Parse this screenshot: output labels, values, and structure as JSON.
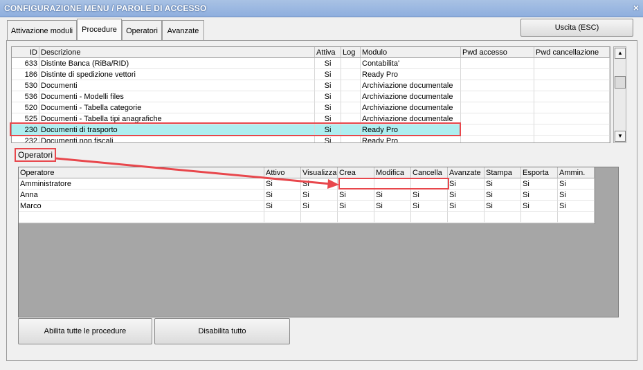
{
  "window": {
    "title": "CONFIGURAZIONE MENU / PAROLE DI ACCESSO",
    "close_glyph": "×"
  },
  "tabs": [
    {
      "label": "Attivazione moduli",
      "active": false
    },
    {
      "label": "Procedure",
      "active": true
    },
    {
      "label": "Operatori",
      "active": false
    },
    {
      "label": "Avanzate",
      "active": false
    }
  ],
  "exit_button": "Uscita (ESC)",
  "procedures": {
    "columns": [
      "ID",
      "Descrizione",
      "Attiva",
      "Log",
      "Modulo",
      "Pwd accesso",
      "Pwd cancellazione"
    ],
    "rows": [
      {
        "id": "633",
        "desc": "Distinte Banca (RiBa/RID)",
        "attiva": "Si",
        "log": "",
        "modulo": "Contabilita'",
        "pwd_acc": "",
        "pwd_canc": ""
      },
      {
        "id": "186",
        "desc": "Distinte di spedizione vettori",
        "attiva": "Si",
        "log": "",
        "modulo": "Ready Pro",
        "pwd_acc": "",
        "pwd_canc": ""
      },
      {
        "id": "530",
        "desc": "Documenti",
        "attiva": "Si",
        "log": "",
        "modulo": "Archiviazione documentale",
        "pwd_acc": "",
        "pwd_canc": ""
      },
      {
        "id": "536",
        "desc": "Documenti - Modelli files",
        "attiva": "Si",
        "log": "",
        "modulo": "Archiviazione documentale",
        "pwd_acc": "",
        "pwd_canc": ""
      },
      {
        "id": "520",
        "desc": "Documenti - Tabella categorie",
        "attiva": "Si",
        "log": "",
        "modulo": "Archiviazione documentale",
        "pwd_acc": "",
        "pwd_canc": ""
      },
      {
        "id": "525",
        "desc": "Documenti - Tabella tipi anagrafiche",
        "attiva": "Si",
        "log": "",
        "modulo": "Archiviazione documentale",
        "pwd_acc": "",
        "pwd_canc": ""
      },
      {
        "id": "230",
        "desc": "Documenti di trasporto",
        "attiva": "Si",
        "log": "",
        "modulo": "Ready Pro",
        "pwd_acc": "",
        "pwd_canc": ""
      },
      {
        "id": "232",
        "desc": "Documenti non fiscali",
        "attiva": "Si",
        "log": "",
        "modulo": "Ready Pro",
        "pwd_acc": "",
        "pwd_canc": ""
      }
    ]
  },
  "operators_label": "Operatori",
  "operators": {
    "columns": [
      "Operatore",
      "Attivo",
      "Visualizza",
      "Crea",
      "Modifica",
      "Cancella",
      "Avanzate",
      "Stampa",
      "Esporta",
      "Ammin."
    ],
    "rows": [
      [
        "Amministratore",
        "Si",
        "Si",
        "",
        "",
        "",
        "Si",
        "Si",
        "Si",
        "Si"
      ],
      [
        "Anna",
        "Si",
        "Si",
        "Si",
        "Si",
        "Si",
        "Si",
        "Si",
        "Si",
        "Si"
      ],
      [
        "Marco",
        "Si",
        "Si",
        "Si",
        "Si",
        "Si",
        "Si",
        "Si",
        "Si",
        "Si"
      ]
    ]
  },
  "buttons": {
    "enable_all": "Abilita tutte le procedure",
    "disable_all": "Disabilita tutto"
  },
  "colors": {
    "selection": "#aeeef0",
    "annotation": "#e8474c",
    "title_bar": "#a9c2e4"
  }
}
